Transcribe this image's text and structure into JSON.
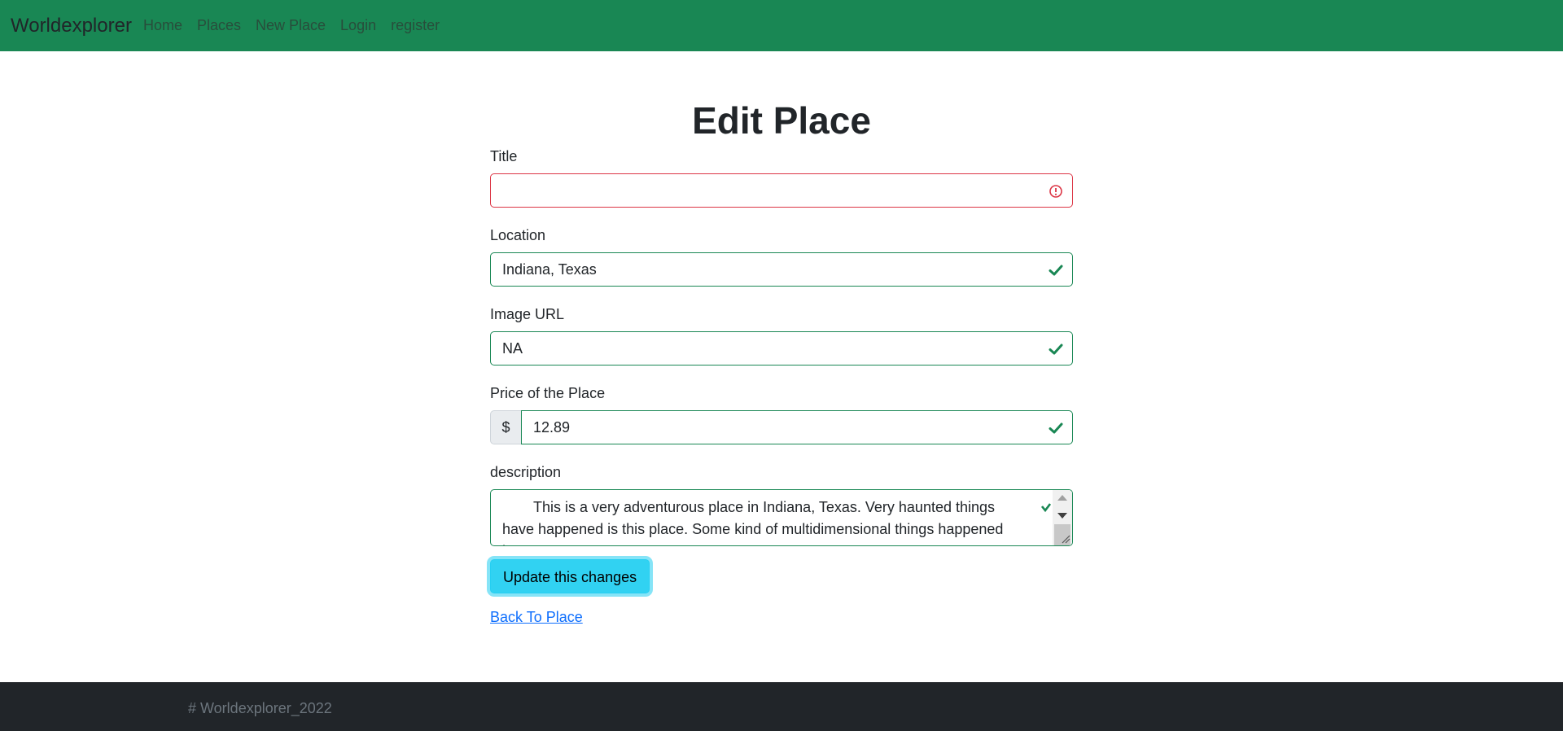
{
  "navbar": {
    "brand": "Worldexplorer",
    "links": [
      "Home",
      "Places",
      "New Place",
      "Login",
      "register"
    ]
  },
  "form": {
    "heading": "Edit Place",
    "title": {
      "label": "Title",
      "value": "",
      "status": "invalid"
    },
    "location": {
      "label": "Location",
      "value": "Indiana, Texas",
      "status": "valid"
    },
    "image_url": {
      "label": "Image URL",
      "value": "NA",
      "status": "valid"
    },
    "price": {
      "label": "Price of the Place",
      "currency_symbol": "$",
      "value": "12.89",
      "status": "valid"
    },
    "description": {
      "label": "description",
      "value": "This is a very adventurous place in Indiana, Texas. Very haunted things have happened is this place. Some kind of multidimensional things happened here",
      "status": "valid"
    },
    "submit_label": "Update this changes",
    "back_link": "Back To Place"
  },
  "footer": {
    "text": "# Worldexplorer_2022"
  },
  "colors": {
    "navbar": "#198754",
    "valid": "#198754",
    "invalid": "#dc3545",
    "button": "#31d2f2",
    "link": "#0d6efd",
    "footer": "#212529"
  }
}
